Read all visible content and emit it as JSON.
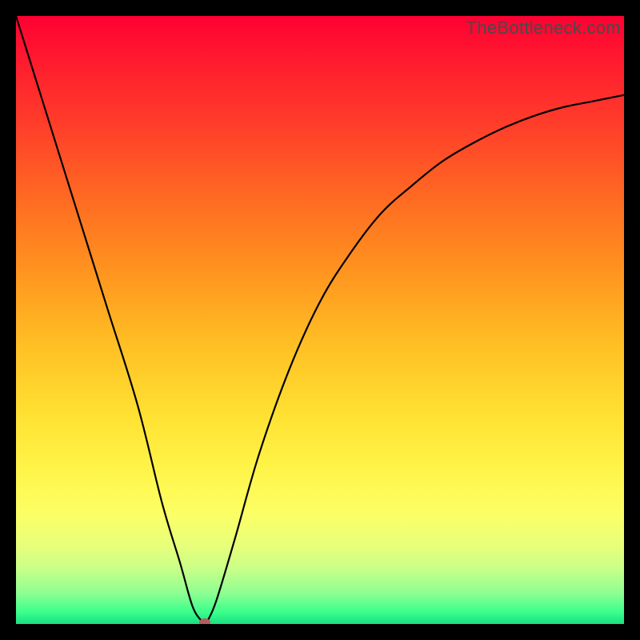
{
  "watermark": "TheBottleneck.com",
  "accent_colors": {
    "top": "#ff0033",
    "mid": "#ffcc33",
    "bottom": "#18e082",
    "curve": "#000000",
    "marker": "#b85a5f"
  },
  "chart_data": {
    "type": "line",
    "title": "",
    "xlabel": "",
    "ylabel": "",
    "xlim": [
      0,
      100
    ],
    "ylim": [
      0,
      100
    ],
    "x": [
      0,
      5,
      10,
      15,
      20,
      24,
      27,
      29,
      30.5,
      31,
      31.5,
      33,
      36,
      40,
      45,
      50,
      55,
      60,
      65,
      70,
      75,
      80,
      85,
      90,
      95,
      100
    ],
    "values": [
      100,
      84,
      68,
      52,
      36,
      20,
      10,
      3,
      0.5,
      0,
      0.5,
      4,
      14,
      28,
      42,
      53,
      61,
      67.5,
      72,
      76,
      79,
      81.5,
      83.5,
      85,
      86,
      87
    ],
    "annotations": [
      {
        "type": "marker",
        "x": 31,
        "y": 0,
        "shape": "oval"
      }
    ]
  }
}
